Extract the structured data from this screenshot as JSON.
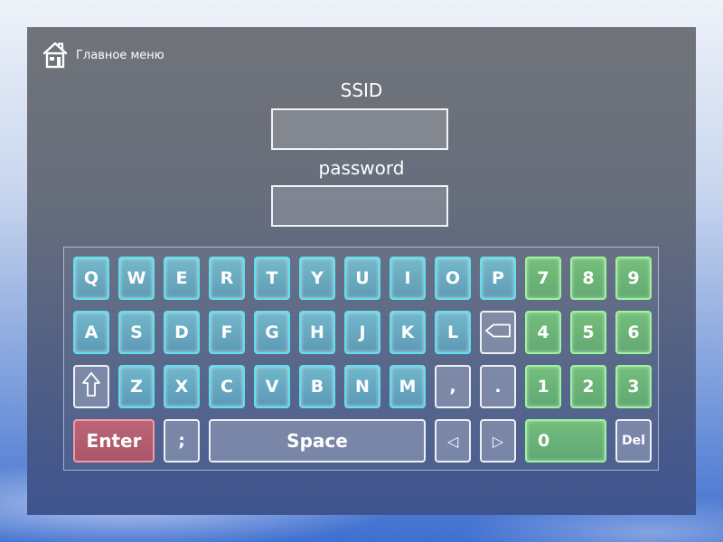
{
  "header": {
    "home_label": "Главное меню",
    "home_icon": "house-icon"
  },
  "form": {
    "ssid_label": "SSID",
    "ssid_value": "",
    "password_label": "password",
    "password_value": ""
  },
  "keyboard": {
    "letter_keys": [
      "Q",
      "W",
      "E",
      "R",
      "T",
      "Y",
      "U",
      "I",
      "O",
      "P",
      "A",
      "S",
      "D",
      "F",
      "G",
      "H",
      "J",
      "K",
      "L",
      "Z",
      "X",
      "C",
      "V",
      "B",
      "N",
      "M"
    ],
    "number_keys": [
      "7",
      "8",
      "9",
      "4",
      "5",
      "6",
      "1",
      "2",
      "3",
      "0"
    ],
    "punct_keys": [
      ",",
      ".",
      ";"
    ],
    "enter_label": "Enter",
    "space_label": "Space",
    "del_label": "Del",
    "left_arrow": "◁",
    "right_arrow": "▷",
    "backspace_icon": "backspace-icon",
    "shift_icon": "shift-arrow-icon"
  },
  "colors": {
    "letter_key": "#7fd0e0",
    "number_key": "#78c878",
    "enter_key": "#c86474",
    "panel": "#6a6e78"
  }
}
